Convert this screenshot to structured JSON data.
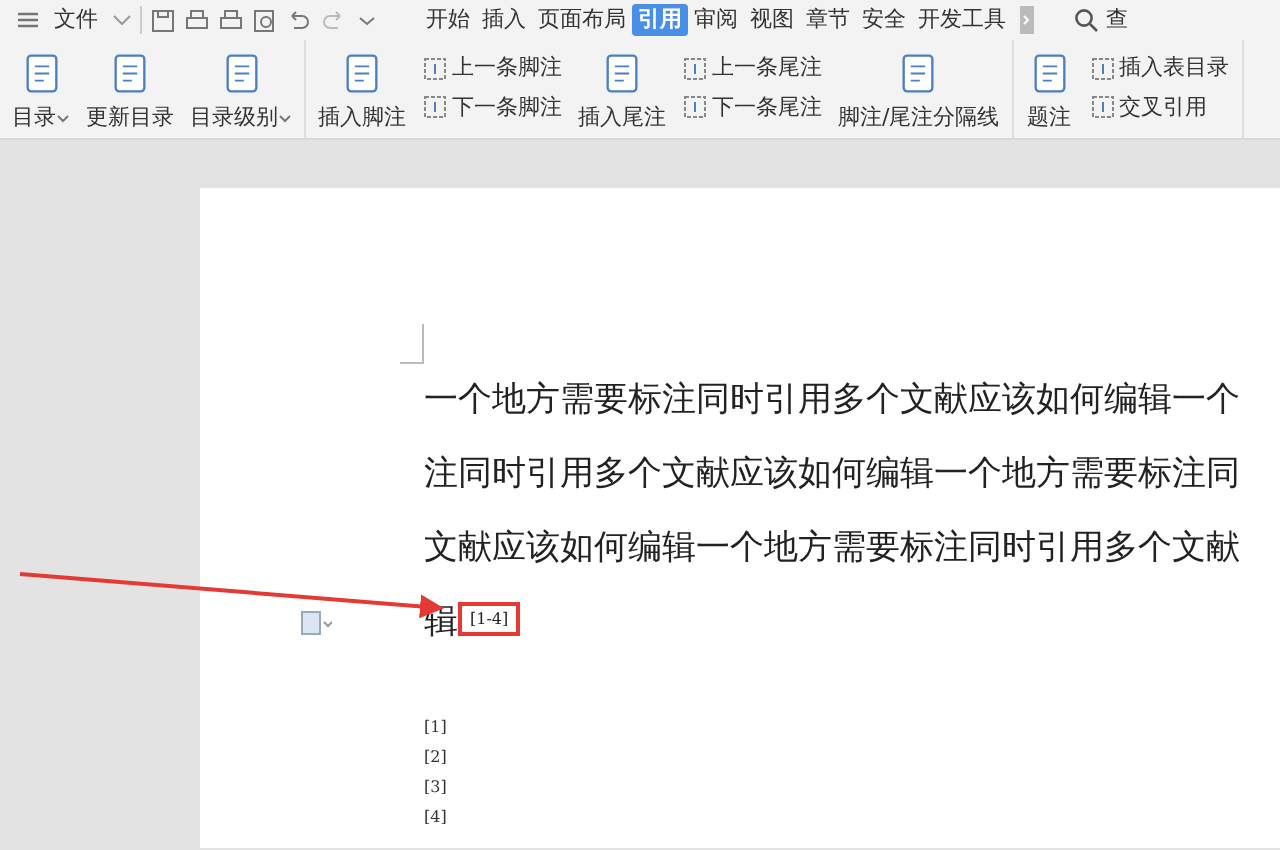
{
  "menu_bar": {
    "menu_label": "文件",
    "tabs": [
      {
        "label": "开始",
        "selected": false
      },
      {
        "label": "插入",
        "selected": false
      },
      {
        "label": "页面布局",
        "selected": false
      },
      {
        "label": "引用",
        "selected": true
      },
      {
        "label": "审阅",
        "selected": false
      },
      {
        "label": "视图",
        "selected": false
      },
      {
        "label": "章节",
        "selected": false
      },
      {
        "label": "安全",
        "selected": false
      },
      {
        "label": "开发工具",
        "selected": false
      }
    ],
    "search_label": "查"
  },
  "ribbon": {
    "groups": [
      {
        "items": [
          {
            "kind": "large",
            "label": "目录",
            "dropdown": true
          },
          {
            "kind": "large",
            "label": "更新目录",
            "dropdown": false
          },
          {
            "kind": "large",
            "label": "目录级别",
            "dropdown": true
          }
        ]
      },
      {
        "items": [
          {
            "kind": "large",
            "label": "插入脚注",
            "dropdown": false
          },
          {
            "kind": "stack",
            "labels": [
              "上一条脚注",
              "下一条脚注"
            ]
          },
          {
            "kind": "large",
            "label": "插入尾注",
            "dropdown": false
          },
          {
            "kind": "stack",
            "labels": [
              "上一条尾注",
              "下一条尾注"
            ]
          },
          {
            "kind": "large",
            "label": "脚注/尾注分隔线",
            "dropdown": false
          }
        ]
      },
      {
        "items": [
          {
            "kind": "large",
            "label": "题注",
            "dropdown": false
          },
          {
            "kind": "stack",
            "labels": [
              "插入表目录",
              "交叉引用"
            ]
          }
        ]
      }
    ]
  },
  "document": {
    "lines": [
      "一个地方需要标注同时引用多个文献应该如何编辑一个",
      "注同时引用多个文献应该如何编辑一个地方需要标注同",
      "文献应该如何编辑一个地方需要标注同时引用多个文献",
      "辑"
    ],
    "citation": {
      "text": "[1-4]",
      "highlighted": true
    },
    "references": [
      "[1]",
      "[2]",
      "[3]",
      "[4]"
    ]
  }
}
